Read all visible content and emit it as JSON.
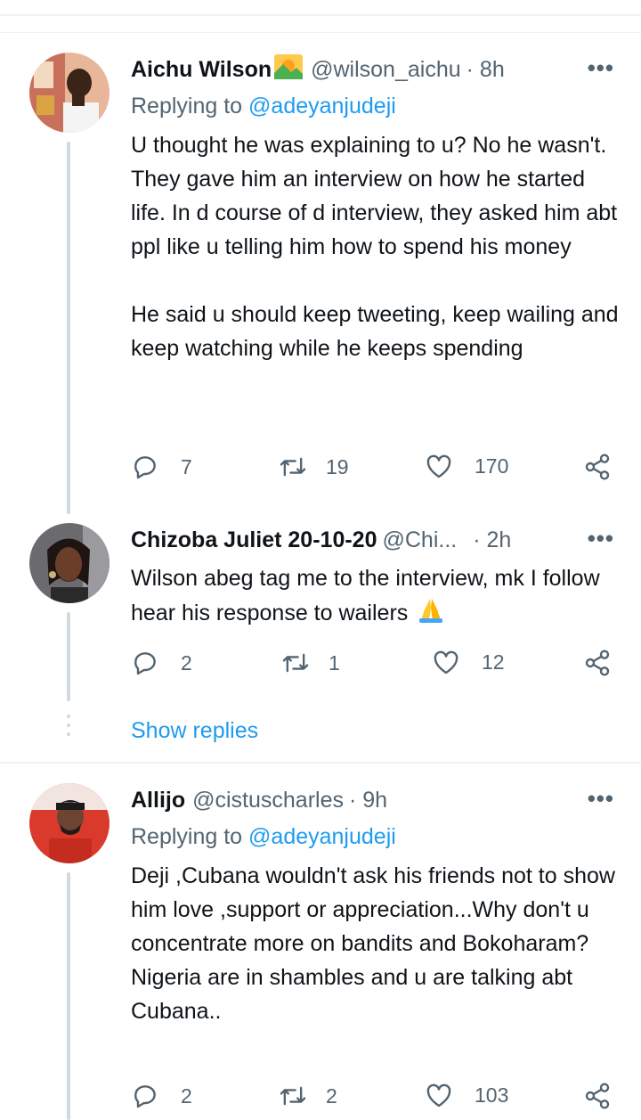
{
  "tweets": [
    {
      "name": "Aichu Wilson",
      "name_emoji": "sunrise-emoji",
      "handle": "@wilson_aichu",
      "time": "· 8h",
      "replying_prefix": "Replying to",
      "replying_to": "@adeyanjudeji",
      "paragraphs": [
        "U thought he was explaining to u? No he wasn't. They gave him an interview on how he started life. In d course of d interview, they asked him abt ppl like u telling him how to spend his money",
        "He said u should keep tweeting, keep wailing and keep watching while he keeps spending"
      ],
      "replies": "7",
      "retweets": "19",
      "likes": "170"
    },
    {
      "name": "Chizoba Juliet 20-10-20",
      "handle": "@Chi...",
      "time": "· 2h",
      "text": "Wilson abeg tag me to the interview,  mk I follow hear his response to wailers",
      "text_emoji": "folded-hands-emoji",
      "replies": "2",
      "retweets": "1",
      "likes": "12"
    },
    {
      "name": "Allijo",
      "handle": "@cistuscharles",
      "time": "· 9h",
      "replying_prefix": "Replying to",
      "replying_to": "@adeyanjudeji",
      "text": "Deji ,Cubana wouldn't ask his friends not to show him love ,support or appreciation...Why don't  u concentrate more on bandits and Bokoharam? Nigeria are in shambles and u are talking abt Cubana..",
      "replies": "2",
      "retweets": "2",
      "likes": "103"
    }
  ],
  "show_replies": "Show replies",
  "more_glyph": "•••",
  "colors": {
    "link": "#1d9bf0",
    "secondary": "#536471",
    "thread_line": "#cfd9de",
    "divider": "#eff3f4"
  }
}
